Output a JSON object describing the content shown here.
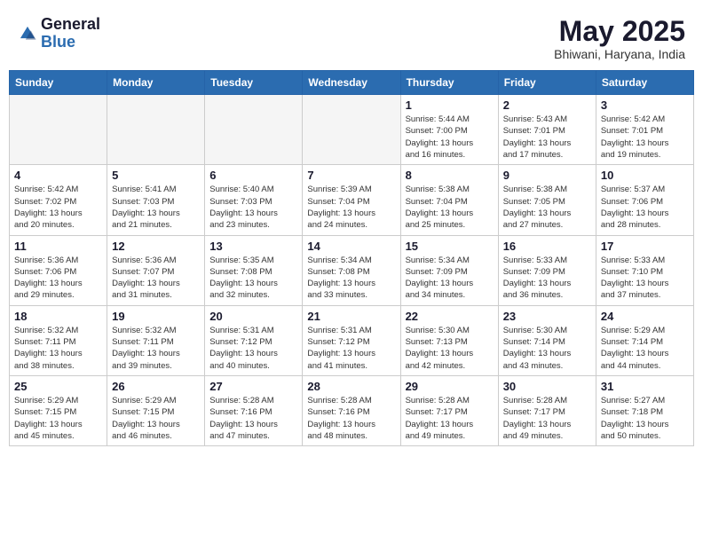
{
  "header": {
    "logo_general": "General",
    "logo_blue": "Blue",
    "month_title": "May 2025",
    "location": "Bhiwani, Haryana, India"
  },
  "weekdays": [
    "Sunday",
    "Monday",
    "Tuesday",
    "Wednesday",
    "Thursday",
    "Friday",
    "Saturday"
  ],
  "weeks": [
    [
      {
        "day": "",
        "detail": ""
      },
      {
        "day": "",
        "detail": ""
      },
      {
        "day": "",
        "detail": ""
      },
      {
        "day": "",
        "detail": ""
      },
      {
        "day": "1",
        "detail": "Sunrise: 5:44 AM\nSunset: 7:00 PM\nDaylight: 13 hours\nand 16 minutes."
      },
      {
        "day": "2",
        "detail": "Sunrise: 5:43 AM\nSunset: 7:01 PM\nDaylight: 13 hours\nand 17 minutes."
      },
      {
        "day": "3",
        "detail": "Sunrise: 5:42 AM\nSunset: 7:01 PM\nDaylight: 13 hours\nand 19 minutes."
      }
    ],
    [
      {
        "day": "4",
        "detail": "Sunrise: 5:42 AM\nSunset: 7:02 PM\nDaylight: 13 hours\nand 20 minutes."
      },
      {
        "day": "5",
        "detail": "Sunrise: 5:41 AM\nSunset: 7:03 PM\nDaylight: 13 hours\nand 21 minutes."
      },
      {
        "day": "6",
        "detail": "Sunrise: 5:40 AM\nSunset: 7:03 PM\nDaylight: 13 hours\nand 23 minutes."
      },
      {
        "day": "7",
        "detail": "Sunrise: 5:39 AM\nSunset: 7:04 PM\nDaylight: 13 hours\nand 24 minutes."
      },
      {
        "day": "8",
        "detail": "Sunrise: 5:38 AM\nSunset: 7:04 PM\nDaylight: 13 hours\nand 25 minutes."
      },
      {
        "day": "9",
        "detail": "Sunrise: 5:38 AM\nSunset: 7:05 PM\nDaylight: 13 hours\nand 27 minutes."
      },
      {
        "day": "10",
        "detail": "Sunrise: 5:37 AM\nSunset: 7:06 PM\nDaylight: 13 hours\nand 28 minutes."
      }
    ],
    [
      {
        "day": "11",
        "detail": "Sunrise: 5:36 AM\nSunset: 7:06 PM\nDaylight: 13 hours\nand 29 minutes."
      },
      {
        "day": "12",
        "detail": "Sunrise: 5:36 AM\nSunset: 7:07 PM\nDaylight: 13 hours\nand 31 minutes."
      },
      {
        "day": "13",
        "detail": "Sunrise: 5:35 AM\nSunset: 7:08 PM\nDaylight: 13 hours\nand 32 minutes."
      },
      {
        "day": "14",
        "detail": "Sunrise: 5:34 AM\nSunset: 7:08 PM\nDaylight: 13 hours\nand 33 minutes."
      },
      {
        "day": "15",
        "detail": "Sunrise: 5:34 AM\nSunset: 7:09 PM\nDaylight: 13 hours\nand 34 minutes."
      },
      {
        "day": "16",
        "detail": "Sunrise: 5:33 AM\nSunset: 7:09 PM\nDaylight: 13 hours\nand 36 minutes."
      },
      {
        "day": "17",
        "detail": "Sunrise: 5:33 AM\nSunset: 7:10 PM\nDaylight: 13 hours\nand 37 minutes."
      }
    ],
    [
      {
        "day": "18",
        "detail": "Sunrise: 5:32 AM\nSunset: 7:11 PM\nDaylight: 13 hours\nand 38 minutes."
      },
      {
        "day": "19",
        "detail": "Sunrise: 5:32 AM\nSunset: 7:11 PM\nDaylight: 13 hours\nand 39 minutes."
      },
      {
        "day": "20",
        "detail": "Sunrise: 5:31 AM\nSunset: 7:12 PM\nDaylight: 13 hours\nand 40 minutes."
      },
      {
        "day": "21",
        "detail": "Sunrise: 5:31 AM\nSunset: 7:12 PM\nDaylight: 13 hours\nand 41 minutes."
      },
      {
        "day": "22",
        "detail": "Sunrise: 5:30 AM\nSunset: 7:13 PM\nDaylight: 13 hours\nand 42 minutes."
      },
      {
        "day": "23",
        "detail": "Sunrise: 5:30 AM\nSunset: 7:14 PM\nDaylight: 13 hours\nand 43 minutes."
      },
      {
        "day": "24",
        "detail": "Sunrise: 5:29 AM\nSunset: 7:14 PM\nDaylight: 13 hours\nand 44 minutes."
      }
    ],
    [
      {
        "day": "25",
        "detail": "Sunrise: 5:29 AM\nSunset: 7:15 PM\nDaylight: 13 hours\nand 45 minutes."
      },
      {
        "day": "26",
        "detail": "Sunrise: 5:29 AM\nSunset: 7:15 PM\nDaylight: 13 hours\nand 46 minutes."
      },
      {
        "day": "27",
        "detail": "Sunrise: 5:28 AM\nSunset: 7:16 PM\nDaylight: 13 hours\nand 47 minutes."
      },
      {
        "day": "28",
        "detail": "Sunrise: 5:28 AM\nSunset: 7:16 PM\nDaylight: 13 hours\nand 48 minutes."
      },
      {
        "day": "29",
        "detail": "Sunrise: 5:28 AM\nSunset: 7:17 PM\nDaylight: 13 hours\nand 49 minutes."
      },
      {
        "day": "30",
        "detail": "Sunrise: 5:28 AM\nSunset: 7:17 PM\nDaylight: 13 hours\nand 49 minutes."
      },
      {
        "day": "31",
        "detail": "Sunrise: 5:27 AM\nSunset: 7:18 PM\nDaylight: 13 hours\nand 50 minutes."
      }
    ]
  ]
}
